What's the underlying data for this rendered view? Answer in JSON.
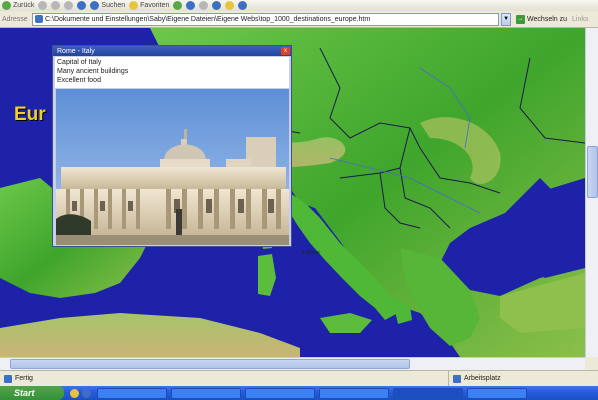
{
  "browser": {
    "toolbar": {
      "back_label": "Zurück",
      "search_label": "Suchen",
      "favorites_label": "Favoriten"
    },
    "address": {
      "label": "Adresse",
      "url": "C:\\Dokumente und Einstellungen\\Saby\\Eigene Dateien\\Eigene Webs\\top_1000_destinations_europe.htm",
      "go_label": "Wechseln zu",
      "links_label": "Links"
    },
    "status": {
      "left_text": "Fertig",
      "zone_text": "Arbeitsplatz"
    }
  },
  "page": {
    "map_title": "Eur",
    "city_labels": {
      "rome": "Rome"
    }
  },
  "popup": {
    "title": "Rome  -  Italy",
    "lines": [
      "Capital of Italy",
      "Many ancient buildings",
      "Excellent food"
    ],
    "close_glyph": "x"
  },
  "taskbar": {
    "start_label": "Start",
    "tasks": [
      "",
      "",
      "",
      "",
      "",
      ""
    ]
  },
  "colors": {
    "sea": "#1d22a8",
    "land_green": "#48b330",
    "title_yellow": "#f0d020",
    "taskbar_blue": "#245edb"
  }
}
